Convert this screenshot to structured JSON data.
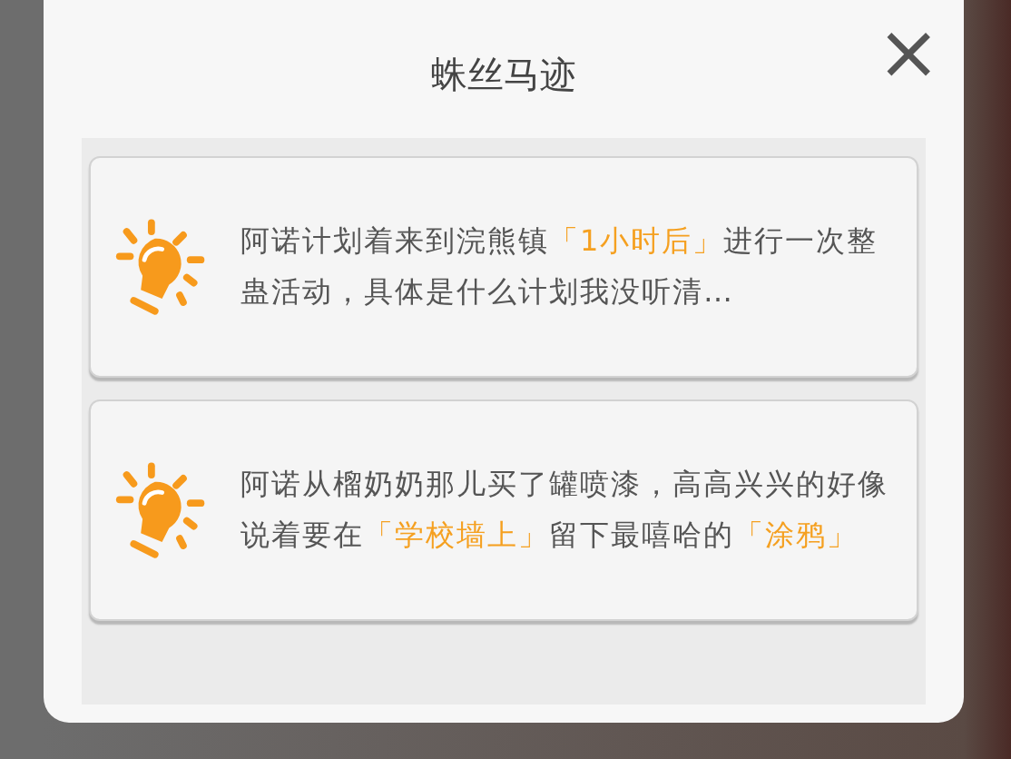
{
  "dialog": {
    "title": "蛛丝马迹",
    "close_label": "×"
  },
  "clues": [
    {
      "segments": [
        {
          "text": "阿诺计划着来到浣熊镇",
          "highlight": false
        },
        {
          "text": "「1小时后」",
          "highlight": true
        },
        {
          "text": "进行一次整蛊活动，具体是什么计划我没听清…",
          "highlight": false
        }
      ]
    },
    {
      "segments": [
        {
          "text": "阿诺从榴奶奶那儿买了罐喷漆，高高兴兴的好像说着要在",
          "highlight": false
        },
        {
          "text": "「学校墙上」",
          "highlight": true
        },
        {
          "text": "留下最嘻哈的",
          "highlight": false
        },
        {
          "text": "「涂鸦」",
          "highlight": true
        }
      ]
    }
  ]
}
